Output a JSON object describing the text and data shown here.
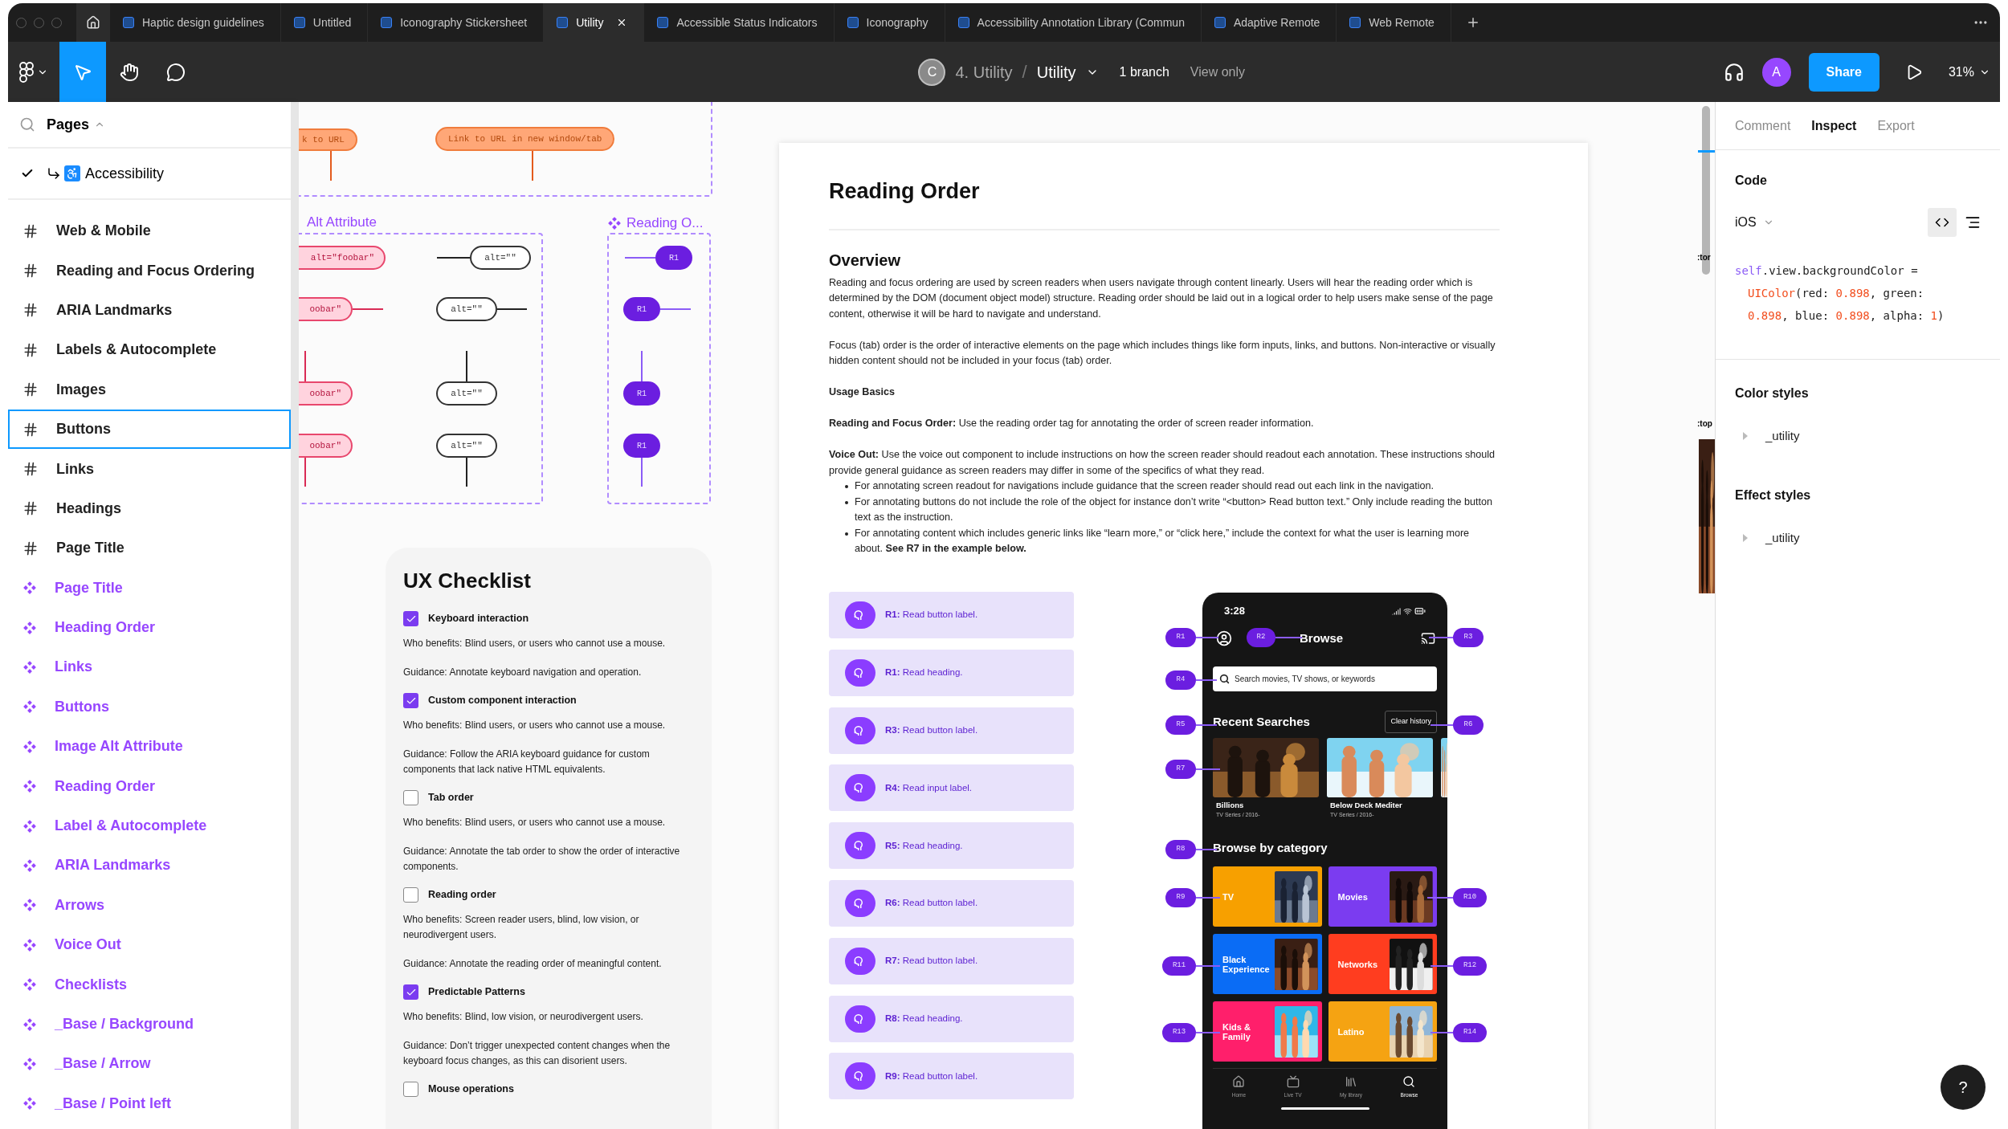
{
  "window": {
    "tabs": [
      {
        "label": "Haptic design guidelines",
        "selected": false
      },
      {
        "label": "Untitled",
        "selected": false
      },
      {
        "label": "Iconography Stickersheet",
        "selected": false
      },
      {
        "label": "Utility",
        "selected": true
      },
      {
        "label": "Accessible Status Indicators",
        "selected": false
      },
      {
        "label": "Iconography",
        "selected": false
      },
      {
        "label": "Accessibility Annotation Library (Commun",
        "selected": false
      },
      {
        "label": "Adaptive Remote",
        "selected": false
      },
      {
        "label": "Web Remote",
        "selected": false
      }
    ]
  },
  "toolbar": {
    "tools": [
      {
        "kind": "move",
        "selected": true
      },
      {
        "kind": "hand",
        "selected": false
      },
      {
        "kind": "comment",
        "selected": false
      }
    ],
    "owner_initial": "C",
    "project": "4. Utility",
    "separator": "/",
    "file": "Utility",
    "branches": "1 branch",
    "mode": "View only",
    "user_initial": "A",
    "share": "Share",
    "zoom": "31%"
  },
  "sidebar": {
    "title": "Pages",
    "current_page": "Accessibility",
    "layers": [
      {
        "label": "Web & Mobile",
        "kind": "frame",
        "selected": false
      },
      {
        "label": "Reading and Focus Ordering",
        "kind": "frame",
        "selected": false
      },
      {
        "label": "ARIA Landmarks",
        "kind": "frame",
        "selected": false
      },
      {
        "label": "Labels & Autocomplete",
        "kind": "frame",
        "selected": false
      },
      {
        "label": "Images",
        "kind": "frame",
        "selected": false
      },
      {
        "label": "Buttons",
        "kind": "frame",
        "selected": true
      },
      {
        "label": "Links",
        "kind": "frame",
        "selected": false
      },
      {
        "label": "Headings",
        "kind": "frame",
        "selected": false
      },
      {
        "label": "Page Title",
        "kind": "frame",
        "selected": false
      },
      {
        "label": "Page Title",
        "kind": "component",
        "selected": false
      },
      {
        "label": "Heading Order",
        "kind": "component",
        "selected": false
      },
      {
        "label": "Links",
        "kind": "component",
        "selected": false
      },
      {
        "label": "Buttons",
        "kind": "component",
        "selected": false
      },
      {
        "label": "Image Alt Attribute",
        "kind": "component",
        "selected": false
      },
      {
        "label": "Reading Order",
        "kind": "component",
        "selected": false
      },
      {
        "label": "Label & Autocomplete",
        "kind": "component",
        "selected": false
      },
      {
        "label": "ARIA Landmarks",
        "kind": "component",
        "selected": false
      },
      {
        "label": "Arrows",
        "kind": "component",
        "selected": false
      },
      {
        "label": "Voice Out",
        "kind": "component",
        "selected": false
      },
      {
        "label": "Checklists",
        "kind": "component",
        "selected": false
      },
      {
        "label": "_Base / Background",
        "kind": "component",
        "selected": false
      },
      {
        "label": "_Base / Arrow",
        "kind": "component",
        "selected": false
      },
      {
        "label": "_Base / Point left",
        "kind": "component",
        "selected": false
      }
    ]
  },
  "canvas": {
    "link_pills": [
      "k to URL",
      "Link to URL in new window/tab"
    ],
    "alt_section": {
      "title": "Alt Attribute",
      "pink_tags": [
        "alt=\"foobar\"",
        "oobar\"",
        "oobar\"",
        "oobar\""
      ],
      "outline_tags": [
        "alt=\"\"",
        "alt=\"\"",
        "alt=\"\"",
        "alt=\"\""
      ]
    },
    "reading_section": {
      "title": "Reading O...",
      "tags": [
        "R1",
        "R1",
        "R1",
        "R1"
      ]
    },
    "checklist": {
      "title": "UX Checklist",
      "items": [
        {
          "label": "Keyboard interaction",
          "checked": true,
          "who": "Who benefits: Blind users, or users who cannot use a mouse.",
          "guidance": "Guidance: Annotate keyboard navigation and operation."
        },
        {
          "label": "Custom component interaction",
          "checked": true,
          "who": "Who benefits: Blind users, or users who cannot use a mouse.",
          "guidance": "Guidance: Follow the ARIA keyboard guidance for custom components that lack native HTML equivalents."
        },
        {
          "label": "Tab order",
          "checked": false,
          "who": "Who benefits: Blind users, or users who cannot use a mouse.",
          "guidance": "Guidance: Annotate the tab order to show the order of interactive components."
        },
        {
          "label": "Reading order",
          "checked": false,
          "who": "Who benefits: Screen reader users, blind, low vision, or neurodivergent users.",
          "guidance": "Guidance: Annotate the reading order of meaningful content."
        },
        {
          "label": "Predictable Patterns",
          "checked": true,
          "who": "Who benefits: Blind, low vision, or neurodivergent users.",
          "guidance": "Guidance: Don’t trigger unexpected content changes when the keyboard focus changes, as this can disorient users."
        },
        {
          "label": "Mouse operations",
          "checked": false
        }
      ]
    },
    "doc": {
      "title": "Reading Order",
      "heading": "Overview",
      "paragraphs": [
        "Reading and focus ordering are used by screen readers when users navigate through content linearly. Users will hear the reading order which is determined by the DOM (document object model) structure. Reading order should be laid out in a logical order to help users make sense of the page content, otherwise it will be hard to navigate and understand.",
        "Focus (tab) order is the order of interactive elements on the page which includes things like form inputs, links, and buttons. Non-interactive or visually hidden content should not be included in your focus (tab) order.",
        "**Usage Basics**",
        "**Reading and Focus Order:** Use the reading order tag for annotating the order of screen reader information.",
        "**Voice Out:** Use the voice out component to include instructions on how the screen reader should readout each annotation. These instructions should provide general guidance as screen readers may differ in some of the specifics of what they read."
      ],
      "bullets": [
        "For annotating screen readout for navigations include guidance that the screen reader should read out each link in the navigation.",
        "For annotating buttons do not include the role of the object for instance don’t write “<button> Read button text.” Only include reading the button text as the instruction.",
        "For annotating content which includes generic links like “learn more,” or “click here,” include the context for what the user is learning more about. **See R7 in the example below.**"
      ]
    },
    "voice_rows": [
      "**R1:** Read button label.",
      "**R1:** Read heading.",
      "**R3:** Read button label.",
      "**R4:** Read input label.",
      "**R5:** Read heading.",
      "**R6:** Read button label.",
      "**R7:** Read button label.",
      "**R8:** Read heading.",
      "**R9:** Read button label."
    ],
    "phone": {
      "time": "3:28",
      "title": "Browse",
      "search_placeholder": "Search movies, TV shows, or keywords",
      "recent_heading": "Recent Searches",
      "clear": "Clear history",
      "shows": [
        {
          "title": "Billions",
          "meta": "TV Series / 2016-"
        },
        {
          "title": "Below Deck Mediter",
          "meta": "TV Series / 2016-"
        }
      ],
      "category_heading": "Browse by category",
      "categories": [
        {
          "label": "TV",
          "color": "#f7a000"
        },
        {
          "label": "Movies",
          "color": "#7b3cf0"
        },
        {
          "label": "Black Experience",
          "color": "#0a6cf5"
        },
        {
          "label": "Networks",
          "color": "#ff3d1f"
        },
        {
          "label": "Kids & Family",
          "color": "#ff1f6b"
        },
        {
          "label": "Latino",
          "color": "#f5a312"
        }
      ],
      "nav": [
        {
          "label": "Home",
          "selected": false
        },
        {
          "label": "Live TV",
          "selected": false
        },
        {
          "label": "My library",
          "selected": false
        },
        {
          "label": "Browse",
          "selected": true
        }
      ],
      "tags": [
        "R1",
        "R2",
        "R3",
        "R4",
        "R5",
        "R6",
        "R7",
        "R8",
        "R9",
        "R10",
        "R11",
        "R12",
        "R13",
        "R14"
      ]
    },
    "edge_labels": [
      ":tor",
      ":top"
    ]
  },
  "inspect": {
    "tabs": [
      {
        "label": "Comment",
        "selected": false
      },
      {
        "label": "Inspect",
        "selected": true
      },
      {
        "label": "Export",
        "selected": false
      }
    ],
    "code_heading": "Code",
    "platform": "iOS",
    "code": [
      [
        {
          "t": "self",
          "kind": "keyword"
        },
        {
          "t": ".view.backgroundColor =",
          "kind": "plain"
        }
      ],
      [
        {
          "t": "UIColor",
          "kind": "type"
        },
        {
          "t": "(red: ",
          "kind": "plain"
        },
        {
          "t": "0.898",
          "kind": "number"
        },
        {
          "t": ", green:",
          "kind": "plain"
        }
      ],
      [
        {
          "t": "0.898",
          "kind": "number"
        },
        {
          "t": ", blue: ",
          "kind": "plain"
        },
        {
          "t": "0.898",
          "kind": "number"
        },
        {
          "t": ", alpha: ",
          "kind": "plain"
        },
        {
          "t": "1",
          "kind": "number"
        },
        {
          "t": ")",
          "kind": "plain"
        }
      ]
    ],
    "color_styles_heading": "Color styles",
    "color_styles": [
      "_utility"
    ],
    "effect_styles_heading": "Effect styles",
    "effect_styles": [
      "_utility"
    ]
  },
  "help": "?"
}
